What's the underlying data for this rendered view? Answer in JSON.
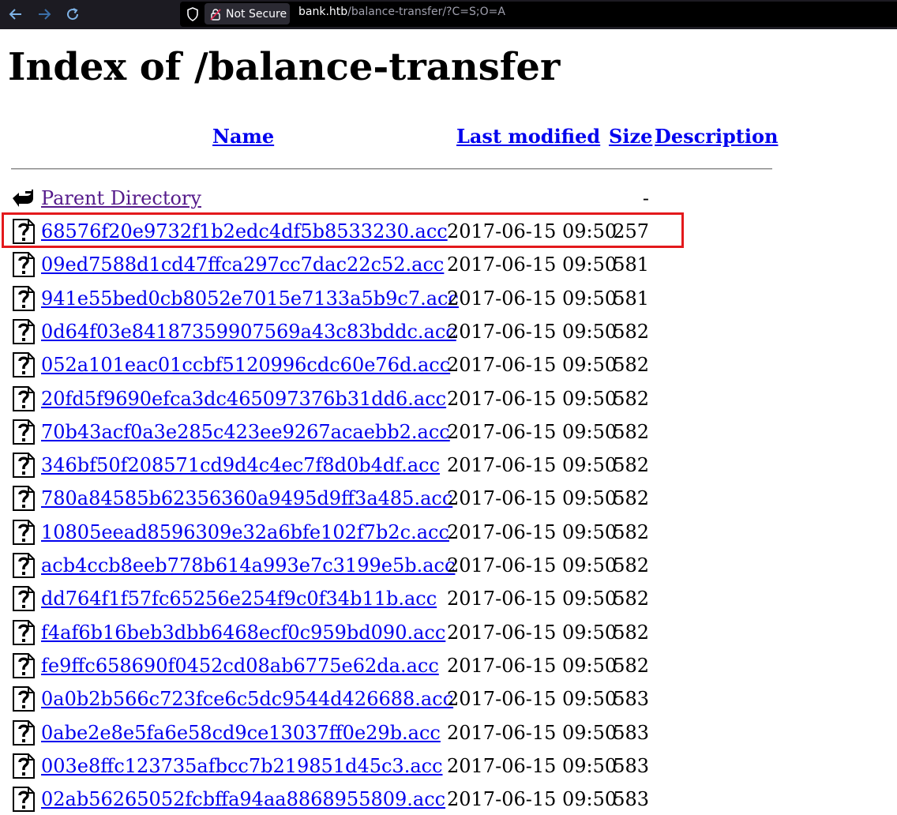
{
  "browser": {
    "security_label": "Not Secure",
    "url_host": "bank.htb",
    "url_path": "/balance-transfer/?C=S;O=A"
  },
  "page": {
    "title": "Index of /balance-transfer",
    "columns": {
      "name": "Name",
      "last_modified": "Last modified",
      "size": "Size",
      "description": "Description"
    },
    "parent": {
      "label": "Parent Directory",
      "size": "-"
    },
    "files": [
      {
        "name": "68576f20e9732f1b2edc4df5b8533230.acc",
        "modified": "2017-06-15 09:50",
        "size": "257"
      },
      {
        "name": "09ed7588d1cd47ffca297cc7dac22c52.acc",
        "modified": "2017-06-15 09:50",
        "size": "581"
      },
      {
        "name": "941e55bed0cb8052e7015e7133a5b9c7.acc",
        "modified": "2017-06-15 09:50",
        "size": "581"
      },
      {
        "name": "0d64f03e84187359907569a43c83bddc.acc",
        "modified": "2017-06-15 09:50",
        "size": "582"
      },
      {
        "name": "052a101eac01ccbf5120996cdc60e76d.acc",
        "modified": "2017-06-15 09:50",
        "size": "582"
      },
      {
        "name": "20fd5f9690efca3dc465097376b31dd6.acc",
        "modified": "2017-06-15 09:50",
        "size": "582"
      },
      {
        "name": "70b43acf0a3e285c423ee9267acaebb2.acc",
        "modified": "2017-06-15 09:50",
        "size": "582"
      },
      {
        "name": "346bf50f208571cd9d4c4ec7f8d0b4df.acc",
        "modified": "2017-06-15 09:50",
        "size": "582"
      },
      {
        "name": "780a84585b62356360a9495d9ff3a485.acc",
        "modified": "2017-06-15 09:50",
        "size": "582"
      },
      {
        "name": "10805eead8596309e32a6bfe102f7b2c.acc",
        "modified": "2017-06-15 09:50",
        "size": "582"
      },
      {
        "name": "acb4ccb8eeb778b614a993e7c3199e5b.acc",
        "modified": "2017-06-15 09:50",
        "size": "582"
      },
      {
        "name": "dd764f1f57fc65256e254f9c0f34b11b.acc",
        "modified": "2017-06-15 09:50",
        "size": "582"
      },
      {
        "name": "f4af6b16beb3dbb6468ecf0c959bd090.acc",
        "modified": "2017-06-15 09:50",
        "size": "582"
      },
      {
        "name": "fe9ffc658690f0452cd08ab6775e62da.acc",
        "modified": "2017-06-15 09:50",
        "size": "582"
      },
      {
        "name": "0a0b2b566c723fce6c5dc9544d426688.acc",
        "modified": "2017-06-15 09:50",
        "size": "583"
      },
      {
        "name": "0abe2e8e5fa6e58cd9ce13037ff0e29b.acc",
        "modified": "2017-06-15 09:50",
        "size": "583"
      },
      {
        "name": "003e8ffc123735afbcc7b219851d45c3.acc",
        "modified": "2017-06-15 09:50",
        "size": "583"
      },
      {
        "name": "02ab56265052fcbffa94aa8868955809.acc",
        "modified": "2017-06-15 09:50",
        "size": "583"
      }
    ]
  },
  "colors": {
    "link": "#0000ee",
    "visited_link": "#551a8b",
    "highlight": "#e3191c",
    "toolbar_bg": "#1c1b22"
  }
}
